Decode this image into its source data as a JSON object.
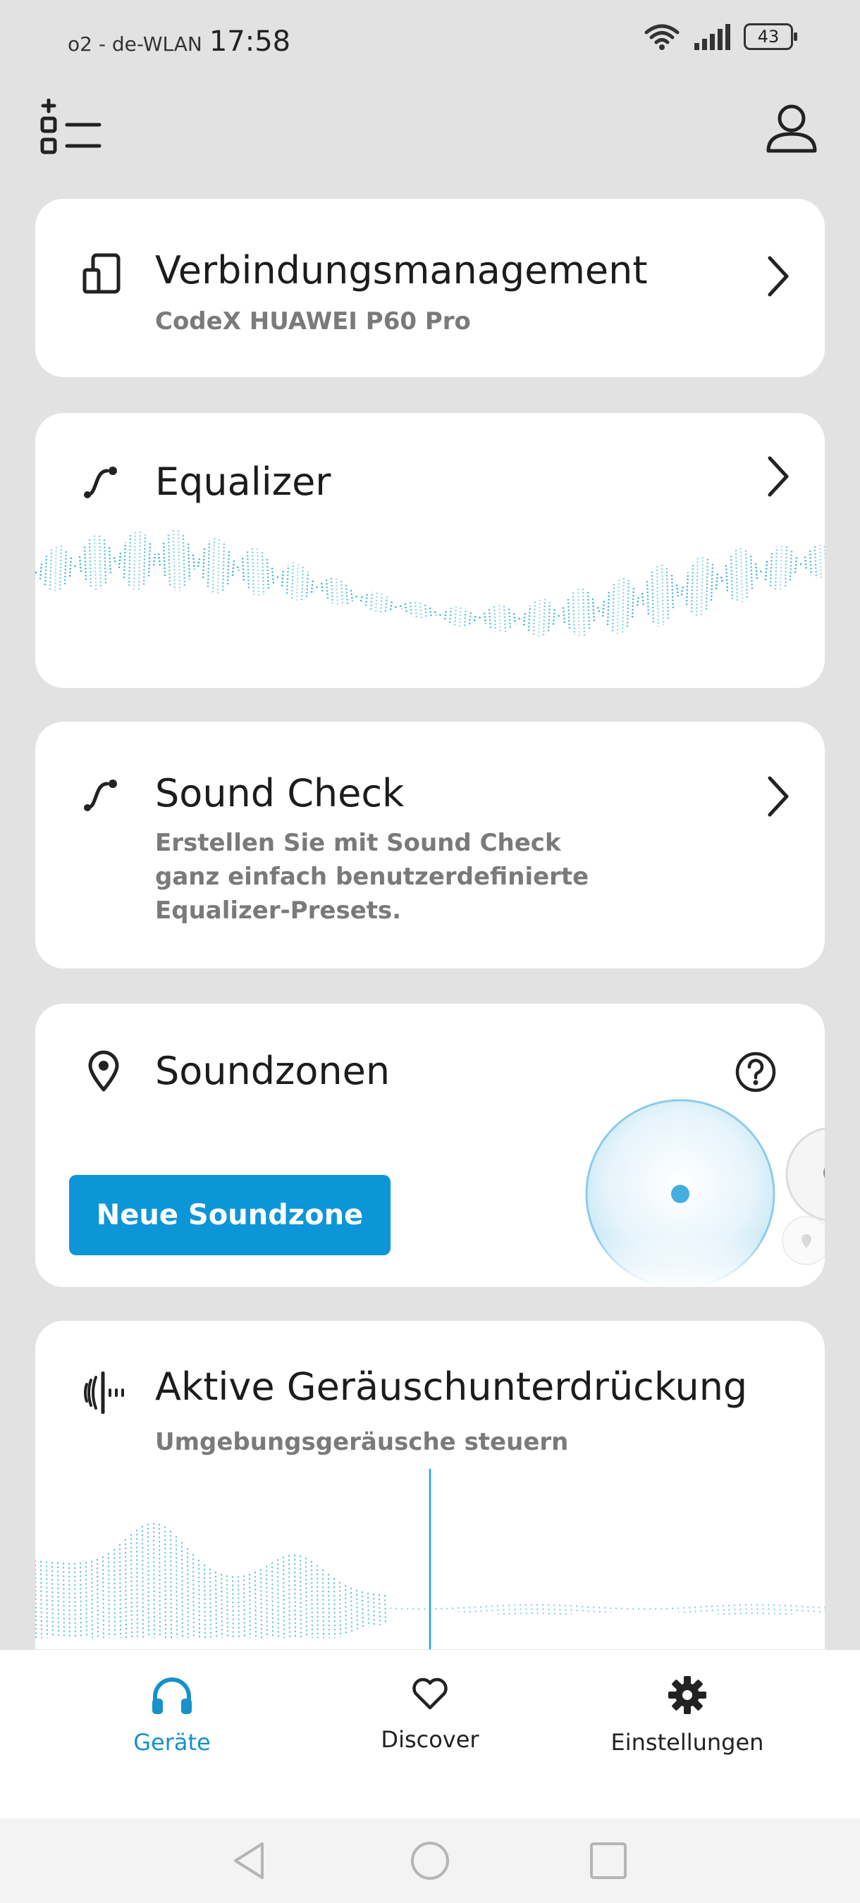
{
  "status_bar": {
    "carrier": "o2 - de-WLAN",
    "time": "17:58",
    "battery": "43"
  },
  "top_bar": {
    "left_icon": "add-list-icon",
    "right_icon": "profile-icon"
  },
  "cards": {
    "connection": {
      "title": "Verbindungsmanagement",
      "subtitle": "CodeX HUAWEI P60 Pro",
      "icon": "devices-icon"
    },
    "equalizer": {
      "title": "Equalizer",
      "icon": "curve-icon"
    },
    "sound_check": {
      "title": "Sound Check",
      "description_lines": [
        "Erstellen Sie mit Sound Check",
        "ganz einfach benutzerdefinierte",
        "Equalizer-Presets."
      ],
      "icon": "curve-icon"
    },
    "soundzones": {
      "title": "Soundzonen",
      "button": "Neue Soundzone",
      "icon": "location-pin-icon",
      "help_icon": "help-icon"
    },
    "anc": {
      "title": "Aktive Geräuschunterdrückung",
      "subtitle": "Umgebungsgeräusche steuern",
      "icon": "noise-cancel-icon"
    }
  },
  "bottom_nav": {
    "items": [
      {
        "label": "Geräte",
        "icon": "headphones-icon",
        "active": true
      },
      {
        "label": "Discover",
        "icon": "heart-icon",
        "active": false
      },
      {
        "label": "Einstellungen",
        "icon": "gear-icon",
        "active": false
      }
    ]
  },
  "colors": {
    "accent": "#0d96d7",
    "active_nav": "#1792c8",
    "wave": "#1ba6c9",
    "background": "#e2e2e2"
  }
}
